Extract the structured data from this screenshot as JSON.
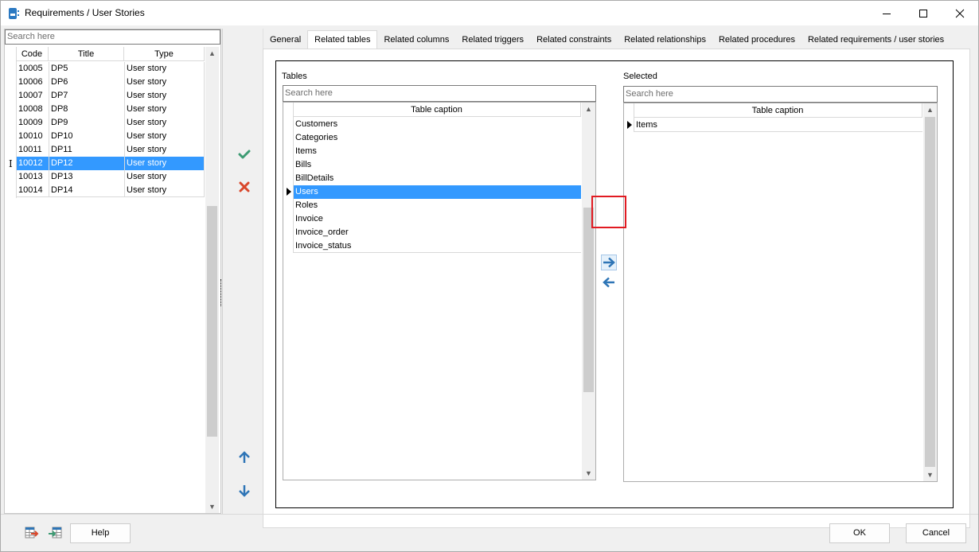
{
  "window": {
    "title": "Requirements / User Stories",
    "controls": {
      "minimize": "minimize",
      "maximize": "maximize",
      "close": "close"
    }
  },
  "left_panel": {
    "search_placeholder": "Search here",
    "columns": [
      "Code",
      "Title",
      "Type"
    ],
    "rows": [
      {
        "code": "10005",
        "title": "DP5",
        "type": "User story",
        "selected": false
      },
      {
        "code": "10006",
        "title": "DP6",
        "type": "User story",
        "selected": false
      },
      {
        "code": "10007",
        "title": "DP7",
        "type": "User story",
        "selected": false
      },
      {
        "code": "10008",
        "title": "DP8",
        "type": "User story",
        "selected": false
      },
      {
        "code": "10009",
        "title": "DP9",
        "type": "User story",
        "selected": false
      },
      {
        "code": "10010",
        "title": "DP10",
        "type": "User story",
        "selected": false
      },
      {
        "code": "10011",
        "title": "DP11",
        "type": "User story",
        "selected": false
      },
      {
        "code": "10012",
        "title": "DP12",
        "type": "User story",
        "selected": true
      },
      {
        "code": "10013",
        "title": "DP13",
        "type": "User story",
        "selected": false
      },
      {
        "code": "10014",
        "title": "DP14",
        "type": "User story",
        "selected": false
      }
    ]
  },
  "actions": {
    "confirm_icon": "checkmark-icon",
    "cancel_icon": "x-icon",
    "move_up_icon": "arrow-up-icon",
    "move_down_icon": "arrow-down-icon",
    "colors": {
      "confirm": "#3d9b73",
      "cancel": "#d9472b",
      "arrow": "#2e75b6"
    }
  },
  "tabs": [
    {
      "label": "General",
      "active": false
    },
    {
      "label": "Related tables",
      "active": true
    },
    {
      "label": "Related columns",
      "active": false
    },
    {
      "label": "Related triggers",
      "active": false
    },
    {
      "label": "Related constraints",
      "active": false
    },
    {
      "label": "Related relationships",
      "active": false
    },
    {
      "label": "Related procedures",
      "active": false
    },
    {
      "label": "Related requirements / user stories",
      "active": false
    }
  ],
  "tables_panel": {
    "label": "Tables",
    "search_placeholder": "Search here",
    "column": "Table caption",
    "rows": [
      {
        "name": "Customers",
        "selected": false
      },
      {
        "name": "Categories",
        "selected": false
      },
      {
        "name": "Items",
        "selected": false
      },
      {
        "name": "Bills",
        "selected": false
      },
      {
        "name": "BillDetails",
        "selected": false
      },
      {
        "name": "Users",
        "selected": true
      },
      {
        "name": "Roles",
        "selected": false
      },
      {
        "name": "Invoice",
        "selected": false
      },
      {
        "name": "Invoice_order",
        "selected": false
      },
      {
        "name": "Invoice_status",
        "selected": false
      }
    ]
  },
  "transfer": {
    "add_icon": "arrow-right-icon",
    "remove_icon": "arrow-left-icon"
  },
  "selected_panel": {
    "label": "Selected",
    "search_placeholder": "Search here",
    "column": "Table caption",
    "rows": [
      {
        "name": "Items",
        "current": true
      }
    ]
  },
  "footer": {
    "export_icon": "table-export-icon",
    "import_icon": "table-import-icon",
    "help_label": "Help",
    "ok_label": "OK",
    "cancel_label": "Cancel"
  }
}
